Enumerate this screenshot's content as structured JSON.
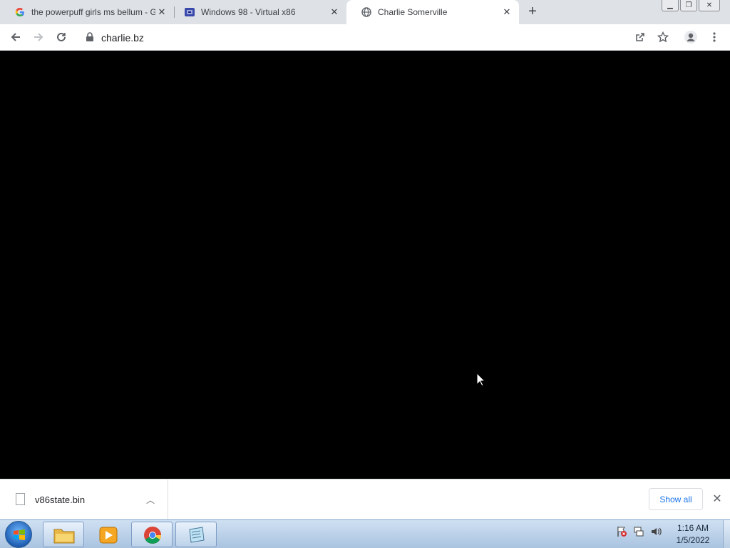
{
  "browser": {
    "tabs": [
      {
        "title": "the powerpuff girls ms bellum - G",
        "favicon": "google-g-icon",
        "active": false
      },
      {
        "title": "Windows 98 - Virtual x86",
        "favicon": "v86-icon",
        "active": false
      },
      {
        "title": "Charlie Somerville",
        "favicon": "globe-icon",
        "active": true
      }
    ],
    "new_tab_icon": "plus-icon",
    "address": "charlie.bz",
    "colors": {
      "tabstrip": "#dee1e6",
      "accent": "#1a73e8",
      "content_bg": "#000000"
    }
  },
  "download_shelf": {
    "file_name": "v86state.bin",
    "show_all_label": "Show all"
  },
  "taskbar": {
    "time": "1:16 AM",
    "date": "1/5/2022",
    "pinned": [
      "windows-explorer-icon",
      "media-player-icon",
      "chrome-icon",
      "notepad-icon"
    ]
  }
}
